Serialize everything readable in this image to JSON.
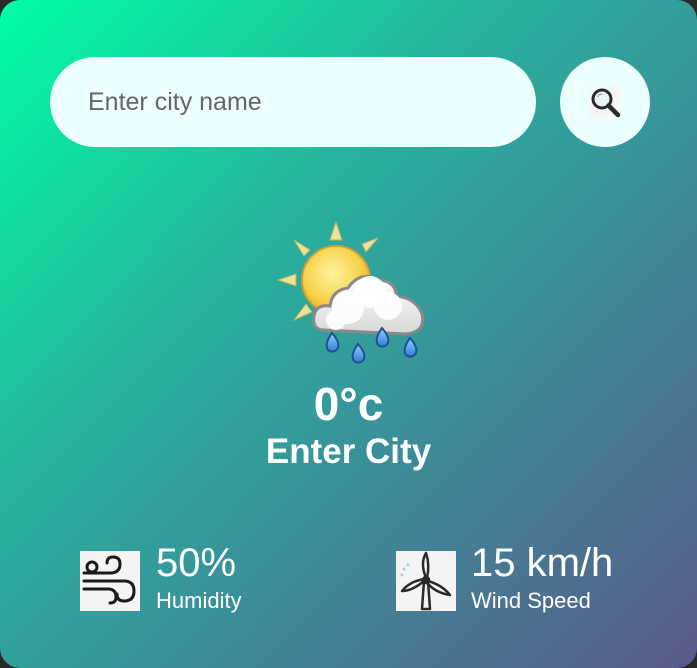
{
  "search": {
    "placeholder": "Enter city name",
    "value": "",
    "button_icon": "search-icon"
  },
  "weather": {
    "icon": "sun-cloud-rain-icon",
    "temperature": "0°c",
    "city": "Enter City"
  },
  "stats": {
    "humidity": {
      "icon": "wind-icon",
      "value": "50%",
      "label": "Humidity"
    },
    "wind": {
      "icon": "wind-turbine-icon",
      "value": "15 km/h",
      "label": "Wind Speed"
    }
  },
  "colors": {
    "gradient_start": "#00fea6",
    "gradient_end": "#5a5a8a",
    "input_background": "#ebfffc",
    "text": "#ffffff"
  }
}
